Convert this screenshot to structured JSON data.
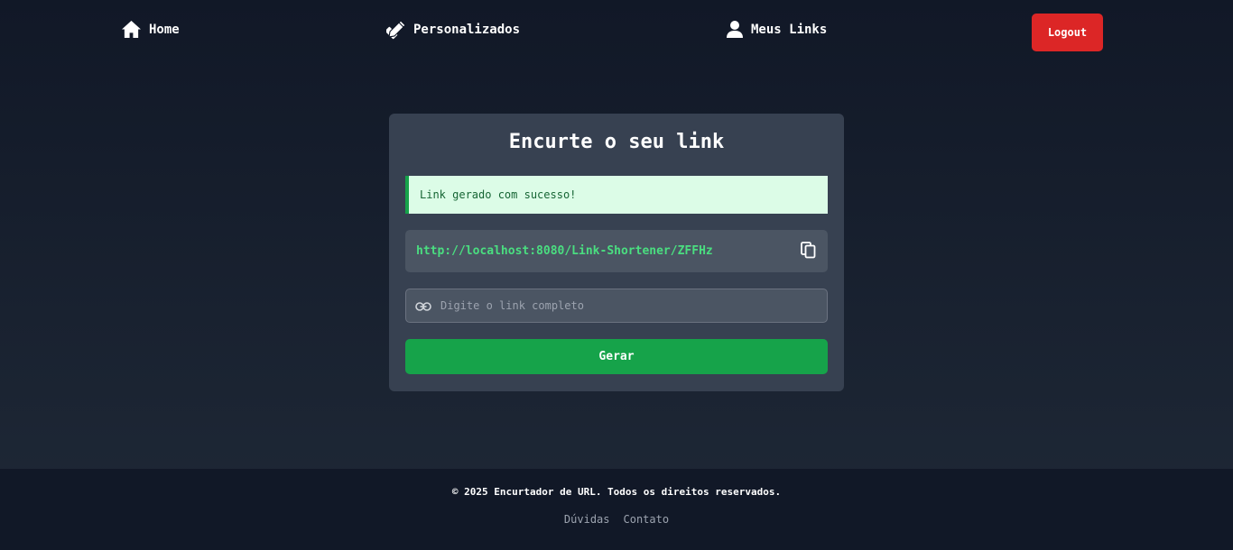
{
  "nav": {
    "home_label": "Home",
    "custom_label": "Personalizados",
    "my_links_label": "Meus Links",
    "logout_label": "Logout"
  },
  "card": {
    "title": "Encurte o seu link",
    "alert": "Link gerado com sucesso!",
    "short_link": "http://localhost:8080/Link-Shortener/ZFFHz",
    "input_placeholder": "Digite o link completo",
    "input_value": "",
    "button_label": "Gerar"
  },
  "footer": {
    "copyright": "© 2025 Encurtador de URL. Todos os direitos reservados.",
    "links": [
      "Dúvidas",
      "Contato"
    ]
  },
  "colors": {
    "background_top": "#111827",
    "background_bottom": "#1f2937",
    "card": "#374151",
    "logout": "#dc2626",
    "success": "#16a34a",
    "link_green": "#4ade80"
  },
  "icons": {
    "home": "home-icon",
    "custom": "pen-ruler-icon",
    "my_links": "user-icon",
    "copy": "copy-icon",
    "link": "link-icon"
  }
}
